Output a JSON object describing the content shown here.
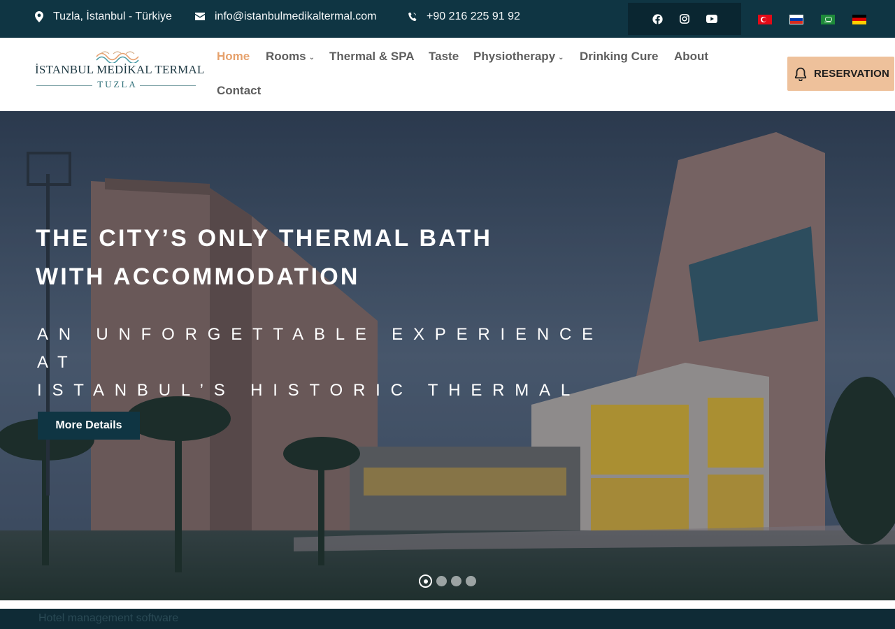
{
  "topbar": {
    "location": "Tuzla, İstanbul - Türkiye",
    "email": "info@istanbulmedikaltermal.com",
    "phone": "+90 216 225 91 92",
    "social": [
      "facebook-icon",
      "instagram-icon",
      "youtube-icon"
    ],
    "flags": [
      "tr-flag",
      "ru-flag",
      "sa-flag",
      "de-flag"
    ]
  },
  "header": {
    "logo": {
      "line1": "İSTANBUL MEDİKAL TERMAL",
      "line2": "TUZLA"
    },
    "nav": {
      "home": "Home",
      "rooms": "Rooms",
      "thermal": "Thermal & SPA",
      "taste": "Taste",
      "physio": "Physiotherapy",
      "drinking": "Drinking Cure",
      "about": "About",
      "contact": "Contact"
    },
    "reservation": "RESERVATION"
  },
  "hero": {
    "title_line1": "THE CITY’S ONLY THERMAL BATH",
    "title_line2": "WITH ACCOMMODATION",
    "subtitle_line1": "AN UNFORGETTABLE EXPERIENCE AT",
    "subtitle_line2": "ISTANBUL’S HISTORIC THERMAL BATH!",
    "button": "More Details",
    "slides_total": 4,
    "slide_active": 1
  },
  "footer": {
    "hotel_software": "Hotel management software"
  },
  "colors": {
    "topbar_bg": "#0f3543",
    "accent": "#e6a16c",
    "reservation_bg": "#eec19b",
    "button_bg": "#0f3543"
  }
}
